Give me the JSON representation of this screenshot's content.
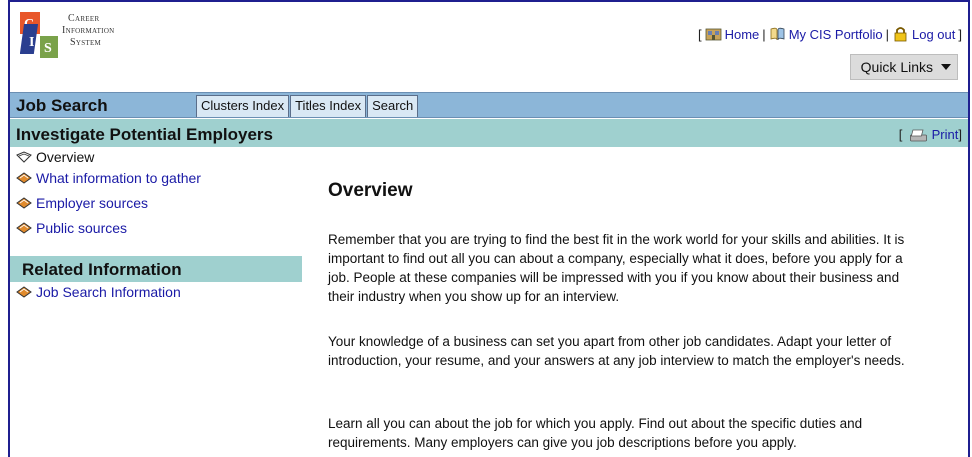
{
  "header": {
    "logo_lines": [
      "Career",
      "Information",
      "System"
    ],
    "links": [
      {
        "label": "Home",
        "icon": "home-icon"
      },
      {
        "label": "My CIS Portfolio",
        "icon": "portfolio-icon"
      },
      {
        "label": "Log out",
        "icon": "lock-icon"
      }
    ],
    "bracket_open": "[",
    "bracket_close": "]",
    "sep": "|",
    "quick_links_label": "Quick Links"
  },
  "section_bar": {
    "title": "Job Search",
    "tabs": [
      "Clusters Index",
      "Titles Index",
      "Search"
    ]
  },
  "page_bar": {
    "title": "Investigate Potential Employers",
    "print_label": "Print"
  },
  "sidebar": {
    "items": [
      "Overview",
      "What information to gather",
      "Employer sources",
      "Public sources"
    ],
    "related_heading": "Related Information",
    "related_items": [
      "Job Search Information"
    ]
  },
  "main": {
    "heading": "Overview",
    "paragraphs": [
      "Remember that you are trying to find the best fit in the work world for your skills and abilities. It is important to find out all you can about a company, especially what it does, before you apply for a job. People at these companies will be impressed with you if you know about their business and their industry when you show up for an interview.",
      "Your knowledge of a business can set you apart from other job candidates. Adapt your letter of introduction, your resume, and your answers at any job interview to match the employer's needs.",
      "Learn all you can about the job for which you apply. Find out about the specific duties and requirements. Many employers can give you job descriptions before you apply."
    ]
  },
  "colors": {
    "blue_bar": "#8cb6d8",
    "teal_bar": "#9fd0cf",
    "link": "#1a1aa6",
    "tab_bg": "#d9e8f4"
  }
}
